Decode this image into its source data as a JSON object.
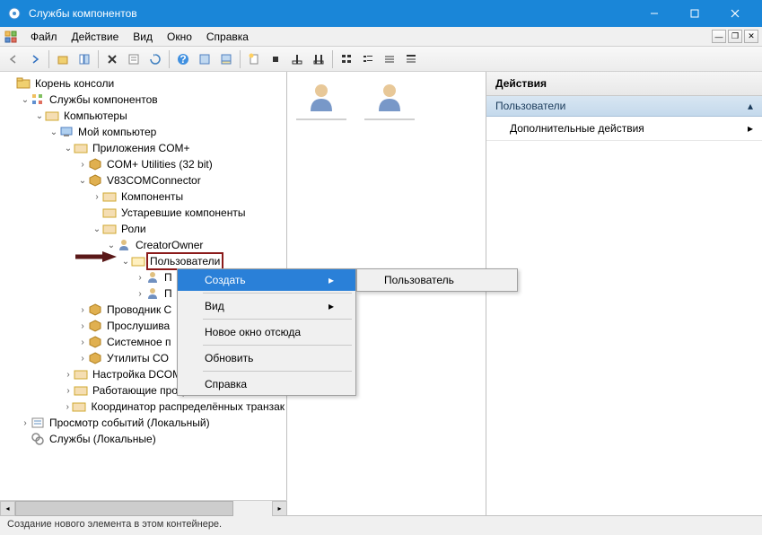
{
  "window": {
    "title": "Службы компонентов"
  },
  "menu": {
    "file": "Файл",
    "action": "Действие",
    "view": "Вид",
    "window": "Окно",
    "help": "Справка"
  },
  "tree": {
    "root": "Корень консоли",
    "comp_services": "Службы компонентов",
    "computers": "Компьютеры",
    "my_computer": "Мой компьютер",
    "com_apps": "Приложения COM+",
    "com_utils": "COM+ Utilities (32 bit)",
    "v83": "V83COMConnector",
    "components": "Компоненты",
    "legacy": "Устаревшие компоненты",
    "roles": "Роли",
    "creator_owner": "CreatorOwner",
    "users_highlighted": "Пользователи",
    "user_trunc1": "П",
    "user_trunc2": "П",
    "provodnik": "Проводник C",
    "listening": "Прослушива",
    "system": "Системное п",
    "util": "Утилиты CO",
    "dcom": "Настройка DCOM",
    "processes": "Работающие процессы",
    "coordinator": "Координатор распределённых транзак",
    "event_viewer": "Просмотр событий (Локальный)",
    "services": "Службы (Локальные)"
  },
  "actions": {
    "header": "Действия",
    "sub": "Пользователи",
    "more": "Дополнительные действия"
  },
  "context": {
    "create": "Создать",
    "view": "Вид",
    "new_window": "Новое окно отсюда",
    "refresh": "Обновить",
    "help": "Справка",
    "sub_user": "Пользователь"
  },
  "status": "Создание нового элемента в этом контейнере."
}
